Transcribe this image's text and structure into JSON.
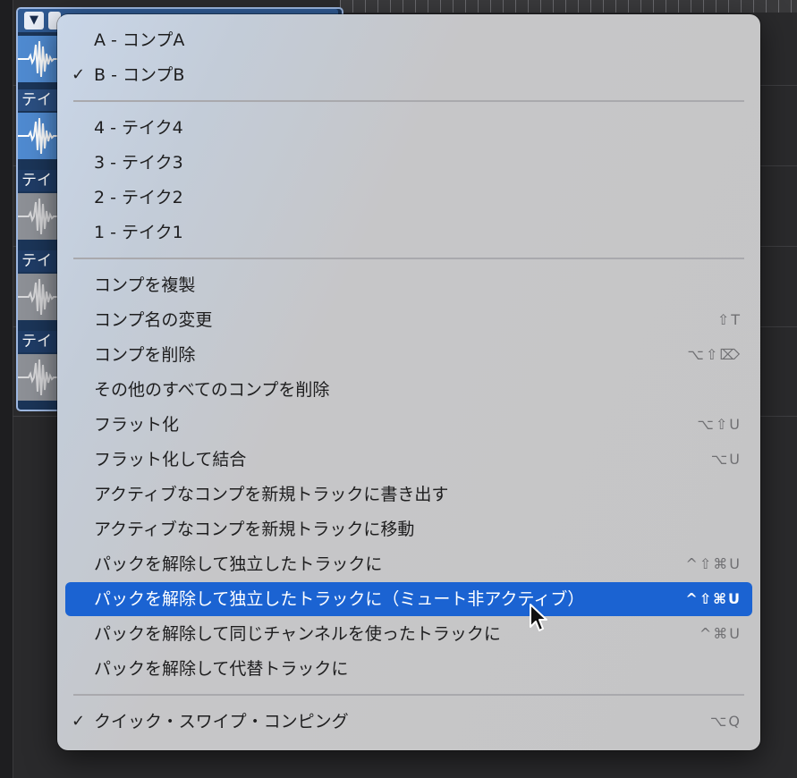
{
  "background": {
    "lane_label": "テイ",
    "lanes": [
      {
        "state": "active"
      },
      {
        "state": "active"
      },
      {
        "state": "inactive"
      },
      {
        "state": "inactive"
      },
      {
        "state": "inactive"
      }
    ]
  },
  "menu": {
    "comps": [
      {
        "label": "A - コンプA",
        "checked": false
      },
      {
        "label": "B - コンプB",
        "checked": true
      }
    ],
    "takes": [
      {
        "label": "4 - テイク4"
      },
      {
        "label": "3 - テイク3"
      },
      {
        "label": "2 - テイク2"
      },
      {
        "label": "1 - テイク1"
      }
    ],
    "actions": [
      {
        "label": "コンプを複製",
        "shortcut": ""
      },
      {
        "label": "コンプ名の変更",
        "shortcut": "⇧T"
      },
      {
        "label": "コンプを削除",
        "shortcut": "⌥⇧⌦"
      },
      {
        "label": "その他のすべてのコンプを削除",
        "shortcut": ""
      },
      {
        "label": "フラット化",
        "shortcut": "⌥⇧U"
      },
      {
        "label": "フラット化して結合",
        "shortcut": "⌥U"
      },
      {
        "label": "アクティブなコンプを新規トラックに書き出す",
        "shortcut": ""
      },
      {
        "label": "アクティブなコンプを新規トラックに移動",
        "shortcut": ""
      },
      {
        "label": "パックを解除して独立したトラックに",
        "shortcut": "^⇧⌘U"
      },
      {
        "label": "パックを解除して独立したトラックに（ミュート非アクティブ）",
        "shortcut": "^⇧⌘U",
        "highlighted": true
      },
      {
        "label": "パックを解除して同じチャンネルを使ったトラックに",
        "shortcut": "^⌘U"
      },
      {
        "label": "パックを解除して代替トラックに",
        "shortcut": ""
      }
    ],
    "quick_swipe": {
      "label": "クイック・スワイプ・コンピング",
      "checked": true,
      "shortcut": "⌥Q"
    },
    "check_glyph": "✓"
  },
  "colors": {
    "highlight": "#1b63d2",
    "region": "#2f5a93"
  }
}
